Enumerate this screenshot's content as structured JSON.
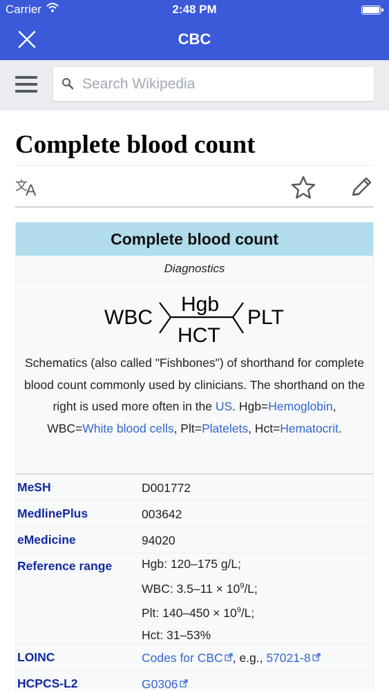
{
  "status_bar": {
    "carrier": "Carrier",
    "time": "2:48 PM"
  },
  "nav": {
    "title": "CBC"
  },
  "search": {
    "placeholder": "Search Wikipedia"
  },
  "article": {
    "title": "Complete blood count"
  },
  "infobox": {
    "title": "Complete blood count",
    "subtitle": "Diagnostics",
    "diagram": {
      "left": "WBC",
      "top": "Hgb",
      "bottom": "HCT",
      "right": "PLT"
    },
    "caption": {
      "part1": "Schematics (also called \"Fishbones\") of shorthand for complete blood count commonly used by clinicians. The shorthand on the right is used more often in the ",
      "link_us": "US",
      "part2": ". Hgb=",
      "link_hemoglobin": "Hemoglobin",
      "part3": ", WBC=",
      "link_wbc": "White blood cells",
      "part4": ", Plt=",
      "link_platelets": "Platelets",
      "part5": ", Hct=",
      "link_hematocrit": "Hematocrit",
      "part6": "."
    },
    "rows": [
      {
        "label": "MeSH",
        "value": "D001772"
      },
      {
        "label": "MedlinePlus",
        "value": "003642"
      },
      {
        "label": "eMedicine",
        "value": "94020"
      },
      {
        "label": "Reference range",
        "lines": [
          "Hgb: 120–175 g/L;",
          "WBC: 3.5–11 × 10",
          "9",
          "/L;",
          "Plt: 140–450 × 10",
          "9",
          "/L;",
          "Hct: 31–53%"
        ]
      },
      {
        "label": "LOINC",
        "link1": "Codes for CBC",
        "mid": ", e.g., ",
        "link2": "57021-8"
      },
      {
        "label": "HCPCS-L2",
        "value": "G0306"
      }
    ]
  },
  "colors": {
    "header": "#3a5ad9",
    "infobox_title": "#b0dcec",
    "link": "#3366cc",
    "label": "#112aa0"
  }
}
